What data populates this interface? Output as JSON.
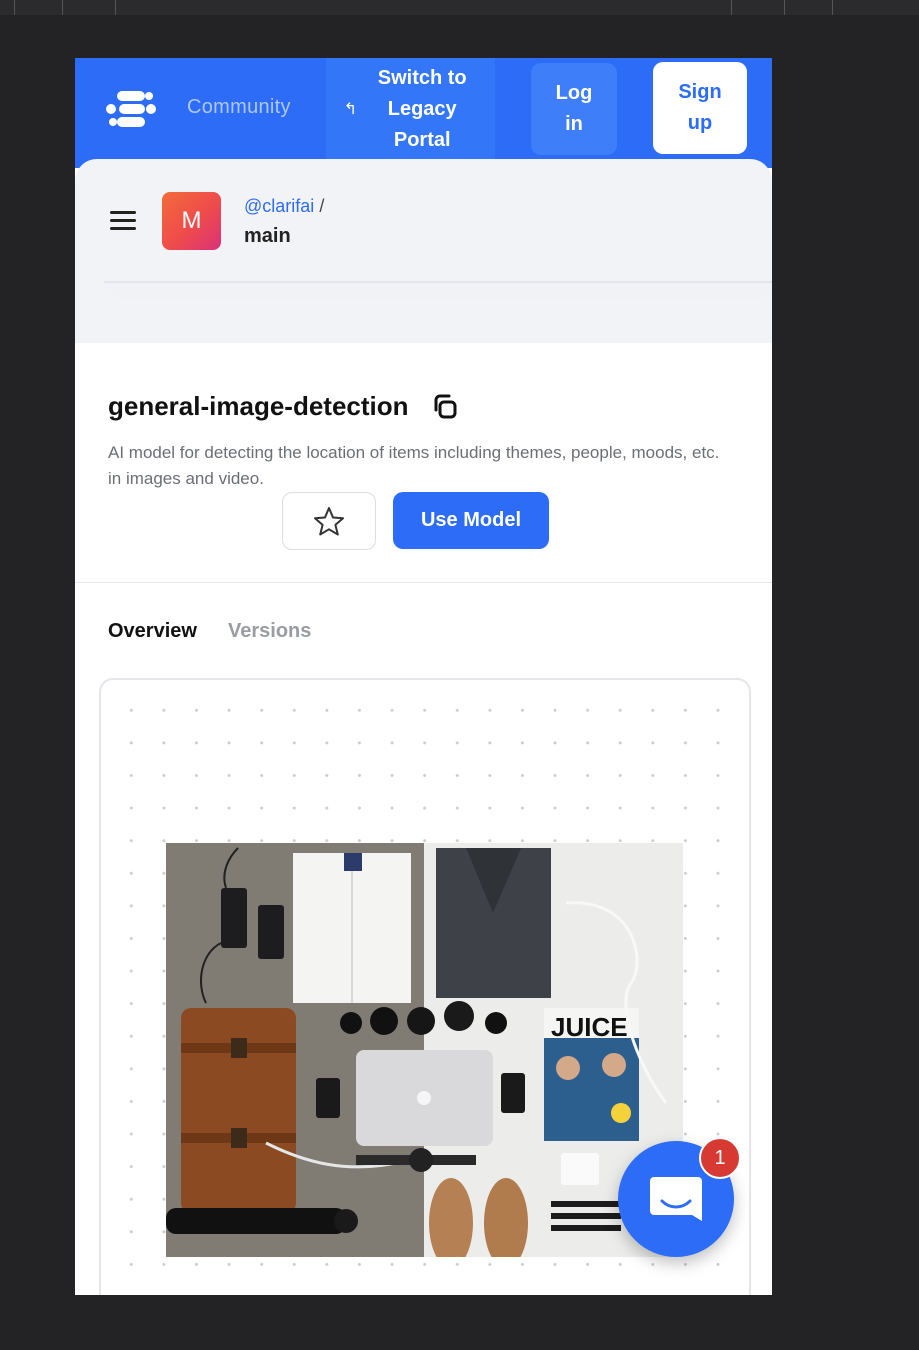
{
  "header": {
    "brand_label": "Community",
    "legacy_label": "Switch to Legacy Portal",
    "legacy_icon": "return-arrow-icon",
    "login_label": "Log in",
    "signup_label": "Sign up",
    "bg_color": "#2c6cf6"
  },
  "breadcrumb": {
    "avatar_letter": "M",
    "owner": "@clarifai",
    "separator": "/",
    "app": "main"
  },
  "model": {
    "title": "general-image-detection",
    "description": "AI model for detecting the location of items including themes, people, moods, etc. in images and video.",
    "use_button": "Use Model"
  },
  "tabs": [
    {
      "label": "Overview",
      "active": true
    },
    {
      "label": "Versions",
      "active": false
    }
  ],
  "chat": {
    "badge_count": "1"
  }
}
